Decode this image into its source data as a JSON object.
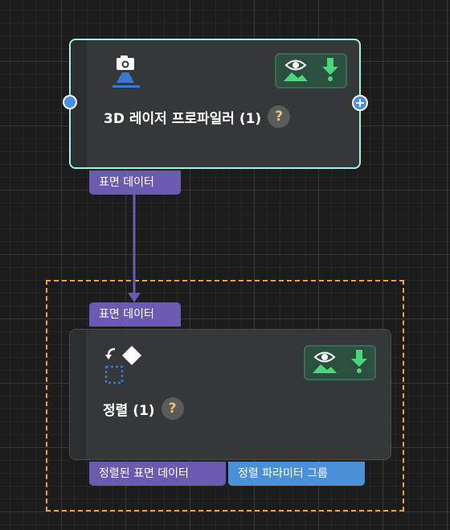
{
  "nodes": [
    {
      "title": "3D 레이저 프로파일러 (1)",
      "help": "?",
      "icon": "camera-laser-icon",
      "output_ports": [
        "표면 데이터"
      ]
    },
    {
      "title": "정렬 (1)",
      "help": "?",
      "icon": "align-transform-icon",
      "input_ports": [
        "표면 데이터"
      ],
      "output_ports": [
        "정렬된 표면 데이터",
        "정렬 파라미터 그룹"
      ]
    }
  ],
  "colors": {
    "selected_border": "#a6f0e6",
    "port_purple": "#6a5bb0",
    "port_blue": "#4a90d9",
    "connection": "#6a5bb0",
    "selection_dash": "#f2a133",
    "port_dot": "#4a90e2",
    "action_green": "#4cd67a"
  },
  "actions": [
    "visibility-icon",
    "download-icon"
  ]
}
